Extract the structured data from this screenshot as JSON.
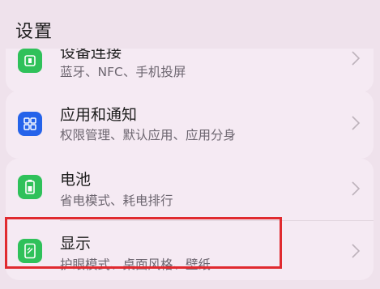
{
  "header": {
    "title": "设置"
  },
  "rows": [
    {
      "title": "设备连接",
      "subtitle": "蓝牙、NFC、手机投屏",
      "icon": "device-connection-icon"
    },
    {
      "title": "应用和通知",
      "subtitle": "权限管理、默认应用、应用分身",
      "icon": "apps-grid-icon"
    },
    {
      "title": "电池",
      "subtitle": "省电模式、耗电排行",
      "icon": "battery-icon"
    },
    {
      "title": "显示",
      "subtitle": "护眼模式、桌面风格、壁纸",
      "icon": "display-icon"
    }
  ],
  "colors": {
    "background": "#efe2ec",
    "card": "#f5eaf3",
    "green_icon": "#2fc15a",
    "blue_icon": "#2563ea",
    "highlight": "#e02a2f"
  }
}
